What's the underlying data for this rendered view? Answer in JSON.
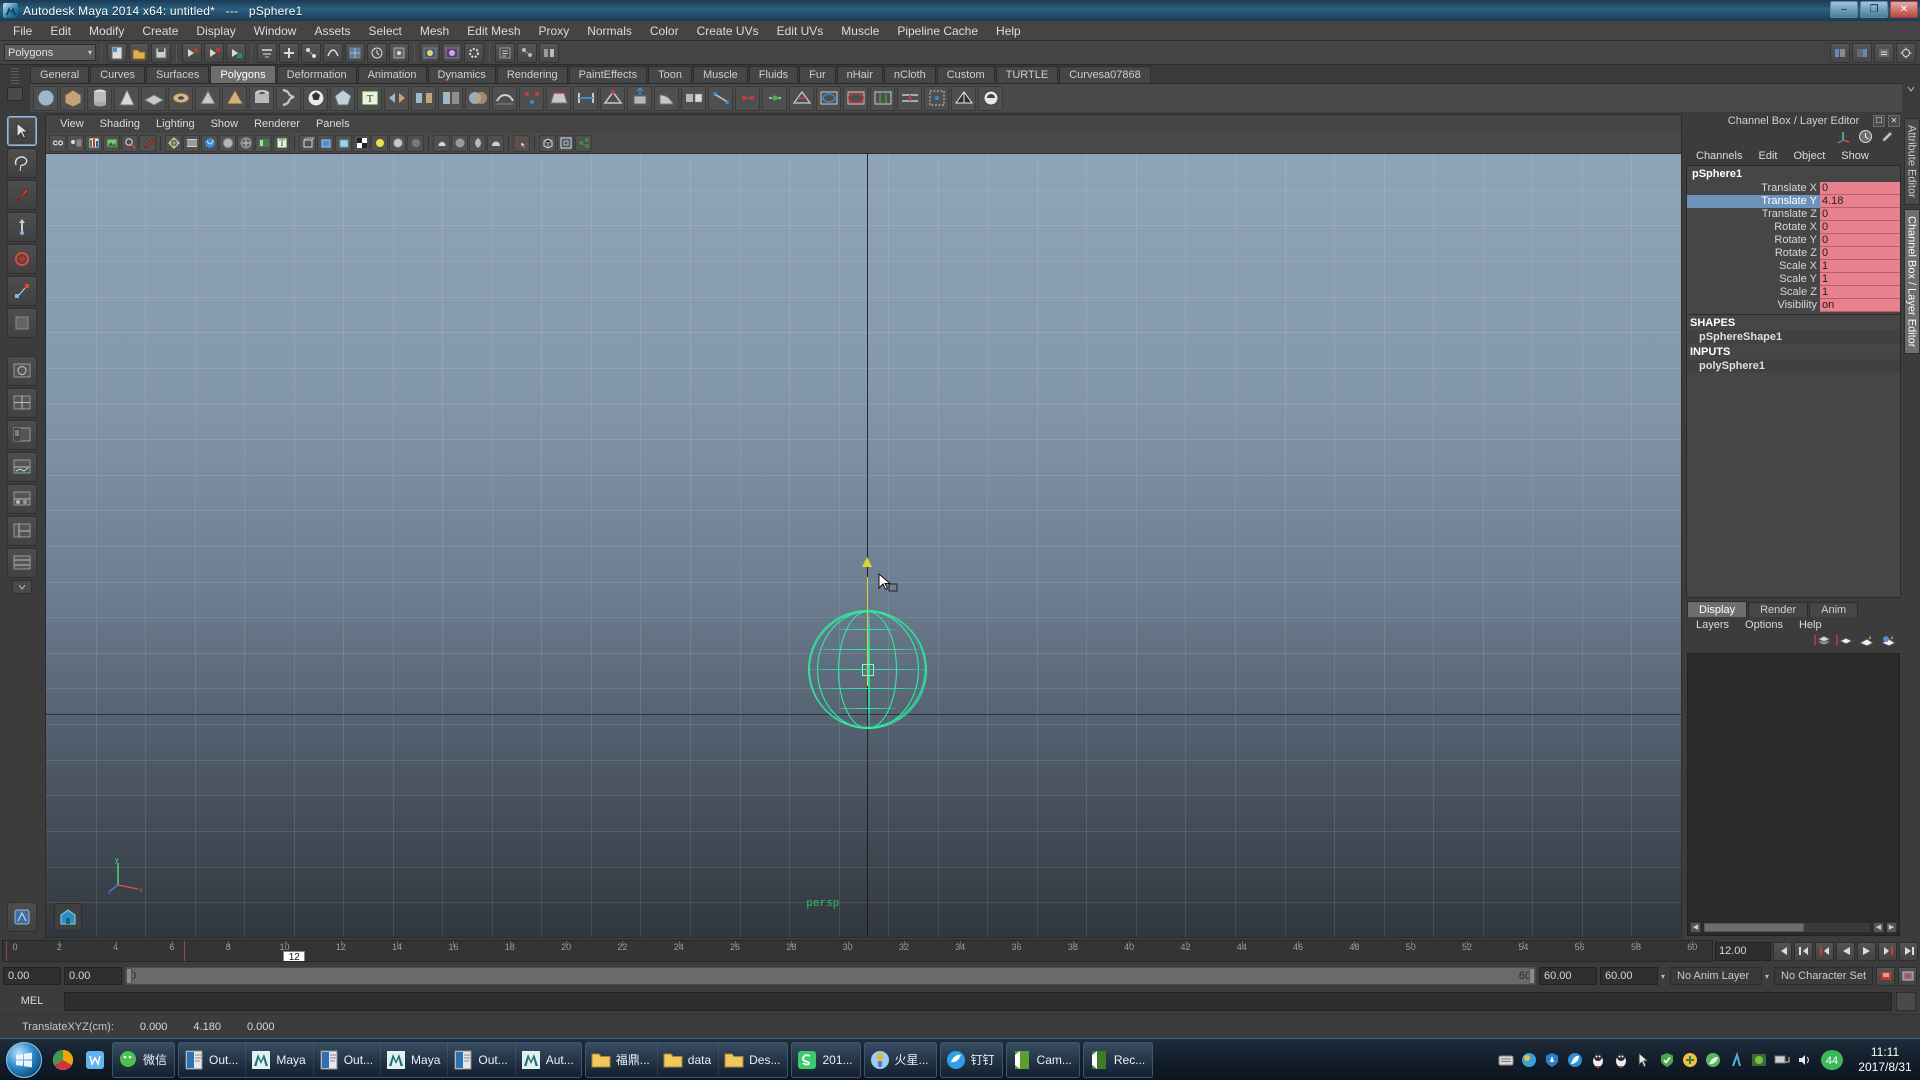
{
  "window": {
    "title": "Autodesk Maya 2014 x64: untitled*   ---   pSphere1",
    "minimize_label": "–",
    "maximize_label": "❐",
    "close_label": "✕"
  },
  "menubar": {
    "items": [
      "File",
      "Edit",
      "Modify",
      "Create",
      "Display",
      "Window",
      "Assets",
      "Select",
      "Mesh",
      "Edit Mesh",
      "Proxy",
      "Normals",
      "Color",
      "Create UVs",
      "Edit UVs",
      "Muscle",
      "Pipeline Cache",
      "Help"
    ]
  },
  "statusline": {
    "mode_selector": "Polygons",
    "mode_caret": "▾"
  },
  "shelf": {
    "tabs": [
      "General",
      "Curves",
      "Surfaces",
      "Polygons",
      "Deformation",
      "Animation",
      "Dynamics",
      "Rendering",
      "PaintEffects",
      "Toon",
      "Muscle",
      "Fluids",
      "Fur",
      "nHair",
      "nCloth",
      "Custom",
      "TURTLE",
      "Curvesa07868"
    ],
    "active_tab": "Polygons"
  },
  "viewport": {
    "panel_menu": [
      "View",
      "Shading",
      "Lighting",
      "Show",
      "Renderer",
      "Panels"
    ],
    "camera_label": "persp",
    "axis_labels": {
      "y": "y",
      "x": "x",
      "z": "z"
    }
  },
  "channel_box": {
    "panel_title": "Channel Box / Layer Editor",
    "menu": [
      "Channels",
      "Edit",
      "Object",
      "Show"
    ],
    "node_name": "pSphere1",
    "channels": [
      {
        "label": "Translate X",
        "value": "0",
        "selected": false
      },
      {
        "label": "Translate Y",
        "value": "4.18",
        "selected": true
      },
      {
        "label": "Translate Z",
        "value": "0",
        "selected": false
      },
      {
        "label": "Rotate X",
        "value": "0",
        "selected": false
      },
      {
        "label": "Rotate Y",
        "value": "0",
        "selected": false
      },
      {
        "label": "Rotate Z",
        "value": "0",
        "selected": false
      },
      {
        "label": "Scale X",
        "value": "1",
        "selected": false
      },
      {
        "label": "Scale Y",
        "value": "1",
        "selected": false
      },
      {
        "label": "Scale Z",
        "value": "1",
        "selected": false
      },
      {
        "label": "Visibility",
        "value": "on",
        "selected": false
      }
    ],
    "shapes_header": "SHAPES",
    "shapes_item": "pSphereShape1",
    "inputs_header": "INPUTS",
    "inputs_item": "polySphere1",
    "value_field_color": "#e8808d",
    "selected_row_color": "#6d93bd"
  },
  "layer_editor": {
    "tabs": [
      "Display",
      "Render",
      "Anim"
    ],
    "active_tab": "Display",
    "menu": [
      "Layers",
      "Options",
      "Help"
    ]
  },
  "dock_tabs": {
    "attribute_editor": "Attribute Editor",
    "channel_box": "Channel Box / Layer Editor"
  },
  "timeline": {
    "ticks": [
      "2",
      "4",
      "6",
      "8",
      "10",
      "12",
      "14",
      "16",
      "18",
      "20",
      "22",
      "24",
      "26",
      "28",
      "30",
      "32",
      "34",
      "36",
      "38",
      "40",
      "42",
      "44",
      "46",
      "48",
      "50",
      "52",
      "54",
      "56",
      "58",
      "60"
    ],
    "start_label": "0",
    "current_frame": "12",
    "current_frame_field": "12.00",
    "range_start_marker": "6"
  },
  "range_slider": {
    "anim_start": "0.00",
    "anim_start2": "0.00",
    "range_start": "0",
    "range_end": "60",
    "playback_end": "60.00",
    "anim_end": "60.00",
    "anim_layer": "No Anim Layer",
    "character_set": "No Character Set"
  },
  "command_line": {
    "language": "MEL",
    "value": ""
  },
  "help_line": {
    "label": "TranslateXYZ(cm):",
    "x": "0.000",
    "y": "4.180",
    "z": "0.000"
  },
  "taskbar": {
    "groups": [
      {
        "items": [
          {
            "label": "微信",
            "icon": "wechat-icon"
          }
        ]
      },
      {
        "items": [
          {
            "label": "Out...",
            "icon": "outlook-icon"
          },
          {
            "label": "Maya",
            "icon": "maya-icon"
          },
          {
            "label": "Out...",
            "icon": "outlook-icon"
          },
          {
            "label": "Maya",
            "icon": "maya-icon"
          },
          {
            "label": "Out...",
            "icon": "outlook-icon"
          },
          {
            "label": "Aut...",
            "icon": "maya-icon"
          }
        ]
      },
      {
        "items": [
          {
            "label": "福鼎...",
            "icon": "folder-icon"
          },
          {
            "label": "data",
            "icon": "folder-icon"
          },
          {
            "label": "Des...",
            "icon": "folder-icon"
          }
        ]
      },
      {
        "items": [
          {
            "label": "201...",
            "icon": "sogou-icon"
          }
        ]
      },
      {
        "items": [
          {
            "label": "火星...",
            "icon": "mars-icon"
          }
        ]
      },
      {
        "items": [
          {
            "label": "钉钉",
            "icon": "dingtalk-icon"
          }
        ]
      },
      {
        "items": [
          {
            "label": "Cam...",
            "icon": "camtasia-icon"
          }
        ]
      },
      {
        "items": [
          {
            "label": "Rec...",
            "icon": "recorder-icon"
          }
        ]
      }
    ],
    "tray_icons": [
      "keyboard-icon",
      "weather-icon",
      "shield-blue-icon",
      "feather-icon",
      "qq-penguin-icon",
      "qq-penguin-icon",
      "mouse-icon",
      "security-icon",
      "plus-green-icon",
      "leaf-icon",
      "lambda-icon",
      "nvidia-icon",
      "network-icon",
      "volume-icon"
    ],
    "badge": "44",
    "clock_time": "11:11",
    "clock_date": "2017/8/31"
  }
}
